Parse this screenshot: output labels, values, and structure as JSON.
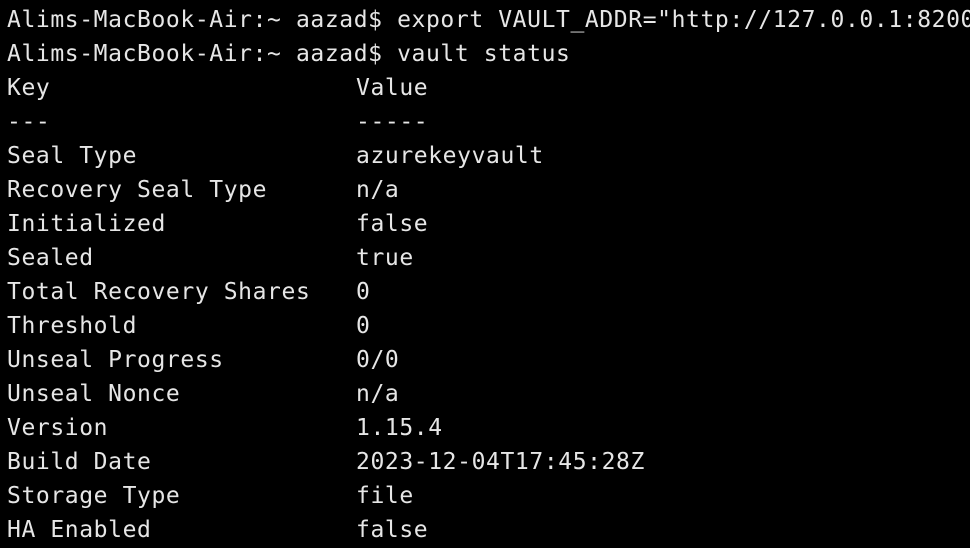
{
  "terminal": {
    "commands": [
      {
        "prompt": "Alims-MacBook-Air:~ aazad$",
        "command": "export VAULT_ADDR=\"http://127.0.0.1:8200\""
      },
      {
        "prompt": "Alims-MacBook-Air:~ aazad$",
        "command": "vault status"
      }
    ],
    "header": {
      "key": "Key",
      "value": "Value"
    },
    "separator": {
      "key": "---",
      "value": "-----"
    },
    "rows": [
      {
        "key": "Seal Type",
        "value": "azurekeyvault"
      },
      {
        "key": "Recovery Seal Type",
        "value": "n/a"
      },
      {
        "key": "Initialized",
        "value": "false"
      },
      {
        "key": "Sealed",
        "value": "true"
      },
      {
        "key": "Total Recovery Shares",
        "value": "0"
      },
      {
        "key": "Threshold",
        "value": "0"
      },
      {
        "key": "Unseal Progress",
        "value": "0/0"
      },
      {
        "key": "Unseal Nonce",
        "value": "n/a"
      },
      {
        "key": "Version",
        "value": "1.15.4"
      },
      {
        "key": "Build Date",
        "value": "2023-12-04T17:45:28Z"
      },
      {
        "key": "Storage Type",
        "value": "file"
      },
      {
        "key": "HA Enabled",
        "value": "false"
      }
    ]
  },
  "colors": {
    "background": "#000000",
    "text": "#e6e6e6"
  }
}
